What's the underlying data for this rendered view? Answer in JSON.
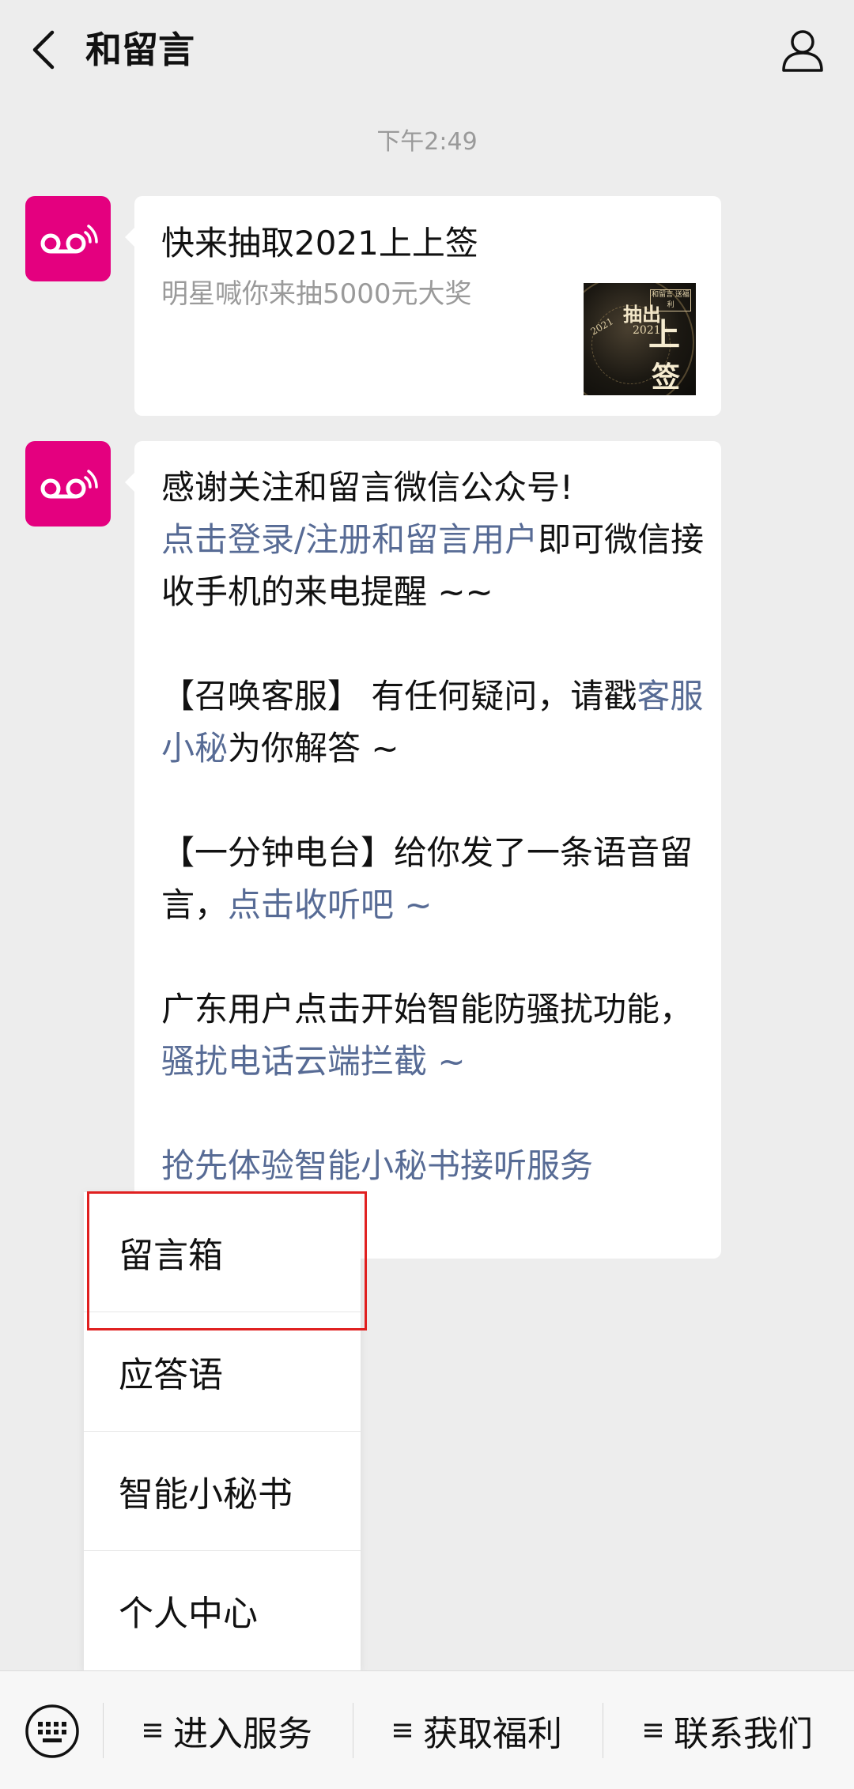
{
  "header": {
    "title": "和留言",
    "back_icon": "chevron-left-icon",
    "profile_icon": "person-icon"
  },
  "chat": {
    "timestamp": "下午2:49",
    "card": {
      "title": "快来抽取2021上上签",
      "subtitle": "明星喊你来抽5000元大奖",
      "thumbnail": {
        "t1": "抽出",
        "t2": "2021",
        "t3": "上",
        "t4": "签",
        "t5": "2021",
        "seal": "和留言 送福利"
      }
    },
    "message": {
      "p1_text": "感谢关注和留言微信公众号!",
      "p2_link": "点击登录/注册和留言用户",
      "p2_text": "即可微信接收手机的来电提醒 ~~",
      "p3_text": "【召唤客服】 有任何疑问，请戳",
      "p3_link": "客服小秘",
      "p3_tail": "为你解答 ~",
      "p4_text": "【一分钟电台】给你发了一条语音留言，",
      "p4_link": "点击收听吧 ~",
      "p5_text": "广东用户点击开始智能防骚扰功能，",
      "p5_link": "骚扰电话云端拦截 ~",
      "p6_link": "抢先体验智能小秘书接听服务"
    }
  },
  "popup_menu": {
    "items": [
      {
        "label": "留言箱"
      },
      {
        "label": "应答语"
      },
      {
        "label": "智能小秘书"
      },
      {
        "label": "个人中心"
      }
    ]
  },
  "bottom_bar": {
    "keyboard_icon": "keyboard-icon",
    "items": [
      {
        "label": "进入服务"
      },
      {
        "label": "获取福利"
      },
      {
        "label": "联系我们"
      }
    ]
  },
  "colors": {
    "brand": "#e4007f",
    "link": "#576b95",
    "highlight": "#e02020",
    "background": "#ededed"
  }
}
